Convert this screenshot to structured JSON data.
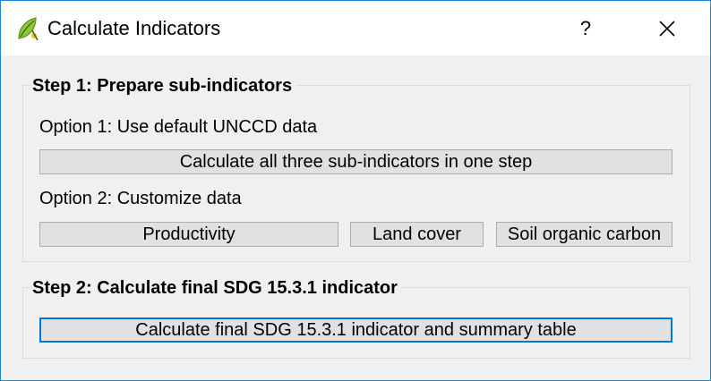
{
  "window": {
    "title": "Calculate Indicators",
    "help_label": "?",
    "app_icon": "qgis-icon",
    "close_icon": "close-icon"
  },
  "step1": {
    "title": "Step 1: Prepare sub-indicators",
    "option1_label": "Option 1: Use default UNCCD data",
    "calc_all_button": "Calculate all three sub-indicators in one step",
    "option2_label": "Option 2: Customize data",
    "productivity_button": "Productivity",
    "land_cover_button": "Land cover",
    "soil_carbon_button": "Soil organic carbon"
  },
  "step2": {
    "title": "Step 2: Calculate final SDG 15.3.1 indicator",
    "final_button": "Calculate final SDG 15.3.1 indicator and summary table"
  },
  "colors": {
    "window_border": "#1883d7",
    "focus_border": "#0078d7",
    "button_bg": "#e1e1e1",
    "dialog_bg": "#f0f0f0"
  }
}
